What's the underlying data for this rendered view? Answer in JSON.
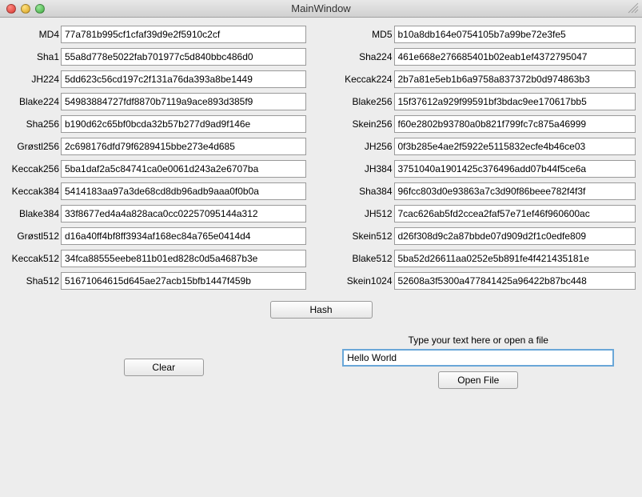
{
  "window": {
    "title": "MainWindow"
  },
  "hashes_left": [
    {
      "label": "MD4",
      "value": "77a781b995cf1cfaf39d9e2f5910c2cf"
    },
    {
      "label": "Sha1",
      "value": "55a8d778e5022fab701977c5d840bbc486d0"
    },
    {
      "label": "JH224",
      "value": "5dd623c56cd197c2f131a76da393a8be1449"
    },
    {
      "label": "Blake224",
      "value": "54983884727fdf8870b7119a9ace893d385f9"
    },
    {
      "label": "Sha256",
      "value": "b190d62c65bf0bcda32b57b277d9ad9f146e"
    },
    {
      "label": "Grøstl256",
      "value": "2c698176dfd79f6289415bbe273e4d685"
    },
    {
      "label": "Keccak256",
      "value": "5ba1daf2a5c84741ca0e0061d243a2e6707ba"
    },
    {
      "label": "Keccak384",
      "value": "5414183aa97a3de68cd8db96adb9aaa0f0b0a"
    },
    {
      "label": "Blake384",
      "value": "33f8677ed4a4a828aca0cc02257095144a312"
    },
    {
      "label": "Grøstl512",
      "value": "d16a40ff4bf8ff3934af168ec84a765e0414d4"
    },
    {
      "label": "Keccak512",
      "value": "34fca88555eebe811b01ed828c0d5a4687b3e"
    },
    {
      "label": "Sha512",
      "value": "51671064615d645ae27acb15bfb1447f459b"
    }
  ],
  "hashes_right": [
    {
      "label": "MD5",
      "value": "b10a8db164e0754105b7a99be72e3fe5"
    },
    {
      "label": "Sha224",
      "value": "461e668e276685401b02eab1ef4372795047"
    },
    {
      "label": "Keccak224",
      "value": "2b7a81e5eb1b6a9758a837372b0d974863b3"
    },
    {
      "label": "Blake256",
      "value": "15f37612a929f99591bf3bdac9ee170617bb5"
    },
    {
      "label": "Skein256",
      "value": "f60e2802b93780a0b821f799fc7c875a46999"
    },
    {
      "label": "JH256",
      "value": "0f3b285e4ae2f5922e5115832ecfe4b46ce03"
    },
    {
      "label": "JH384",
      "value": "3751040a1901425c376496add07b44f5ce6a"
    },
    {
      "label": "Sha384",
      "value": "96fcc803d0e93863a7c3d90f86beee782f4f3f"
    },
    {
      "label": "JH512",
      "value": "7cac626ab5fd2ccea2faf57e71ef46f960600ac"
    },
    {
      "label": "Skein512",
      "value": "d26f308d9c2a87bbde07d909d2f1c0edfe809"
    },
    {
      "label": "Blake512",
      "value": "5ba52d26611aa0252e5b891fe4f421435181e"
    },
    {
      "label": "Skein1024",
      "value": "52608a3f5300a477841425a96422b87bc448"
    }
  ],
  "buttons": {
    "hash": "Hash",
    "clear": "Clear",
    "open_file": "Open File"
  },
  "input": {
    "hint": "Type your text here or open a file",
    "value": "Hello World"
  }
}
